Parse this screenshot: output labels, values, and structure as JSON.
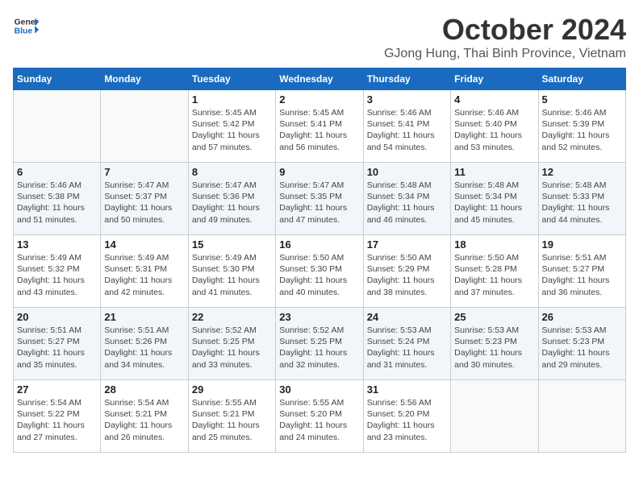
{
  "logo": {
    "line1": "General",
    "line2": "Blue"
  },
  "title": "October 2024",
  "location": "GJong Hung, Thai Binh Province, Vietnam",
  "weekdays": [
    "Sunday",
    "Monday",
    "Tuesday",
    "Wednesday",
    "Thursday",
    "Friday",
    "Saturday"
  ],
  "weeks": [
    [
      {
        "day": "",
        "info": ""
      },
      {
        "day": "",
        "info": ""
      },
      {
        "day": "1",
        "info": "Sunrise: 5:45 AM\nSunset: 5:42 PM\nDaylight: 11 hours and 57 minutes."
      },
      {
        "day": "2",
        "info": "Sunrise: 5:45 AM\nSunset: 5:41 PM\nDaylight: 11 hours and 56 minutes."
      },
      {
        "day": "3",
        "info": "Sunrise: 5:46 AM\nSunset: 5:41 PM\nDaylight: 11 hours and 54 minutes."
      },
      {
        "day": "4",
        "info": "Sunrise: 5:46 AM\nSunset: 5:40 PM\nDaylight: 11 hours and 53 minutes."
      },
      {
        "day": "5",
        "info": "Sunrise: 5:46 AM\nSunset: 5:39 PM\nDaylight: 11 hours and 52 minutes."
      }
    ],
    [
      {
        "day": "6",
        "info": "Sunrise: 5:46 AM\nSunset: 5:38 PM\nDaylight: 11 hours and 51 minutes."
      },
      {
        "day": "7",
        "info": "Sunrise: 5:47 AM\nSunset: 5:37 PM\nDaylight: 11 hours and 50 minutes."
      },
      {
        "day": "8",
        "info": "Sunrise: 5:47 AM\nSunset: 5:36 PM\nDaylight: 11 hours and 49 minutes."
      },
      {
        "day": "9",
        "info": "Sunrise: 5:47 AM\nSunset: 5:35 PM\nDaylight: 11 hours and 47 minutes."
      },
      {
        "day": "10",
        "info": "Sunrise: 5:48 AM\nSunset: 5:34 PM\nDaylight: 11 hours and 46 minutes."
      },
      {
        "day": "11",
        "info": "Sunrise: 5:48 AM\nSunset: 5:34 PM\nDaylight: 11 hours and 45 minutes."
      },
      {
        "day": "12",
        "info": "Sunrise: 5:48 AM\nSunset: 5:33 PM\nDaylight: 11 hours and 44 minutes."
      }
    ],
    [
      {
        "day": "13",
        "info": "Sunrise: 5:49 AM\nSunset: 5:32 PM\nDaylight: 11 hours and 43 minutes."
      },
      {
        "day": "14",
        "info": "Sunrise: 5:49 AM\nSunset: 5:31 PM\nDaylight: 11 hours and 42 minutes."
      },
      {
        "day": "15",
        "info": "Sunrise: 5:49 AM\nSunset: 5:30 PM\nDaylight: 11 hours and 41 minutes."
      },
      {
        "day": "16",
        "info": "Sunrise: 5:50 AM\nSunset: 5:30 PM\nDaylight: 11 hours and 40 minutes."
      },
      {
        "day": "17",
        "info": "Sunrise: 5:50 AM\nSunset: 5:29 PM\nDaylight: 11 hours and 38 minutes."
      },
      {
        "day": "18",
        "info": "Sunrise: 5:50 AM\nSunset: 5:28 PM\nDaylight: 11 hours and 37 minutes."
      },
      {
        "day": "19",
        "info": "Sunrise: 5:51 AM\nSunset: 5:27 PM\nDaylight: 11 hours and 36 minutes."
      }
    ],
    [
      {
        "day": "20",
        "info": "Sunrise: 5:51 AM\nSunset: 5:27 PM\nDaylight: 11 hours and 35 minutes."
      },
      {
        "day": "21",
        "info": "Sunrise: 5:51 AM\nSunset: 5:26 PM\nDaylight: 11 hours and 34 minutes."
      },
      {
        "day": "22",
        "info": "Sunrise: 5:52 AM\nSunset: 5:25 PM\nDaylight: 11 hours and 33 minutes."
      },
      {
        "day": "23",
        "info": "Sunrise: 5:52 AM\nSunset: 5:25 PM\nDaylight: 11 hours and 32 minutes."
      },
      {
        "day": "24",
        "info": "Sunrise: 5:53 AM\nSunset: 5:24 PM\nDaylight: 11 hours and 31 minutes."
      },
      {
        "day": "25",
        "info": "Sunrise: 5:53 AM\nSunset: 5:23 PM\nDaylight: 11 hours and 30 minutes."
      },
      {
        "day": "26",
        "info": "Sunrise: 5:53 AM\nSunset: 5:23 PM\nDaylight: 11 hours and 29 minutes."
      }
    ],
    [
      {
        "day": "27",
        "info": "Sunrise: 5:54 AM\nSunset: 5:22 PM\nDaylight: 11 hours and 27 minutes."
      },
      {
        "day": "28",
        "info": "Sunrise: 5:54 AM\nSunset: 5:21 PM\nDaylight: 11 hours and 26 minutes."
      },
      {
        "day": "29",
        "info": "Sunrise: 5:55 AM\nSunset: 5:21 PM\nDaylight: 11 hours and 25 minutes."
      },
      {
        "day": "30",
        "info": "Sunrise: 5:55 AM\nSunset: 5:20 PM\nDaylight: 11 hours and 24 minutes."
      },
      {
        "day": "31",
        "info": "Sunrise: 5:56 AM\nSunset: 5:20 PM\nDaylight: 11 hours and 23 minutes."
      },
      {
        "day": "",
        "info": ""
      },
      {
        "day": "",
        "info": ""
      }
    ]
  ]
}
